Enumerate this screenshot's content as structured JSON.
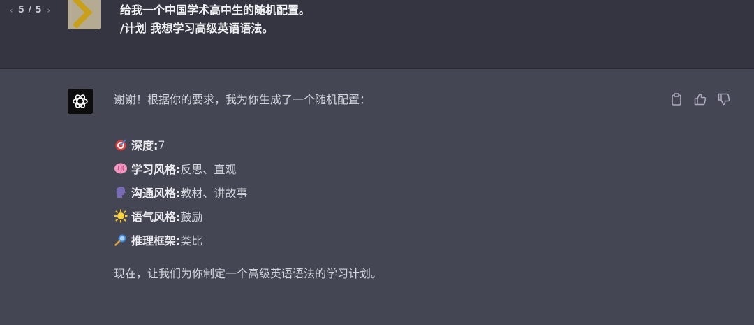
{
  "pager": {
    "prev_icon": "chevron-left-icon",
    "count": "5 / 5",
    "next_icon": "chevron-right-icon"
  },
  "user_message": {
    "avatar_icon": "user-avatar-logo",
    "lines": [
      "给我一个中国学术高中生的随机配置。",
      "/计划 我想学习高级英语语法。"
    ]
  },
  "assistant_message": {
    "avatar_icon": "openai-logo-icon",
    "intro": "谢谢！根据你的要求，我为你生成了一个随机配置：",
    "settings": [
      {
        "icon": "target-icon",
        "key": "深度:",
        "value": "7"
      },
      {
        "icon": "brain-icon",
        "key": "学习风格:",
        "value": "反思、直观"
      },
      {
        "icon": "speaking-head-icon",
        "key": "沟通风格:",
        "value": "教材、讲故事"
      },
      {
        "icon": "sun-icon",
        "key": "语气风格:",
        "value": "鼓励"
      },
      {
        "icon": "magnifier-icon",
        "key": "推理框架:",
        "value": "类比"
      }
    ],
    "closing": "现在，让我们为你制定一个高级英语语法的学习计划。"
  },
  "actions": [
    "copy-icon",
    "thumbs-up-icon",
    "thumbs-down-icon"
  ],
  "colors": {
    "user_bg": "#343541",
    "assistant_bg": "#444654",
    "text": "#ececf1"
  }
}
